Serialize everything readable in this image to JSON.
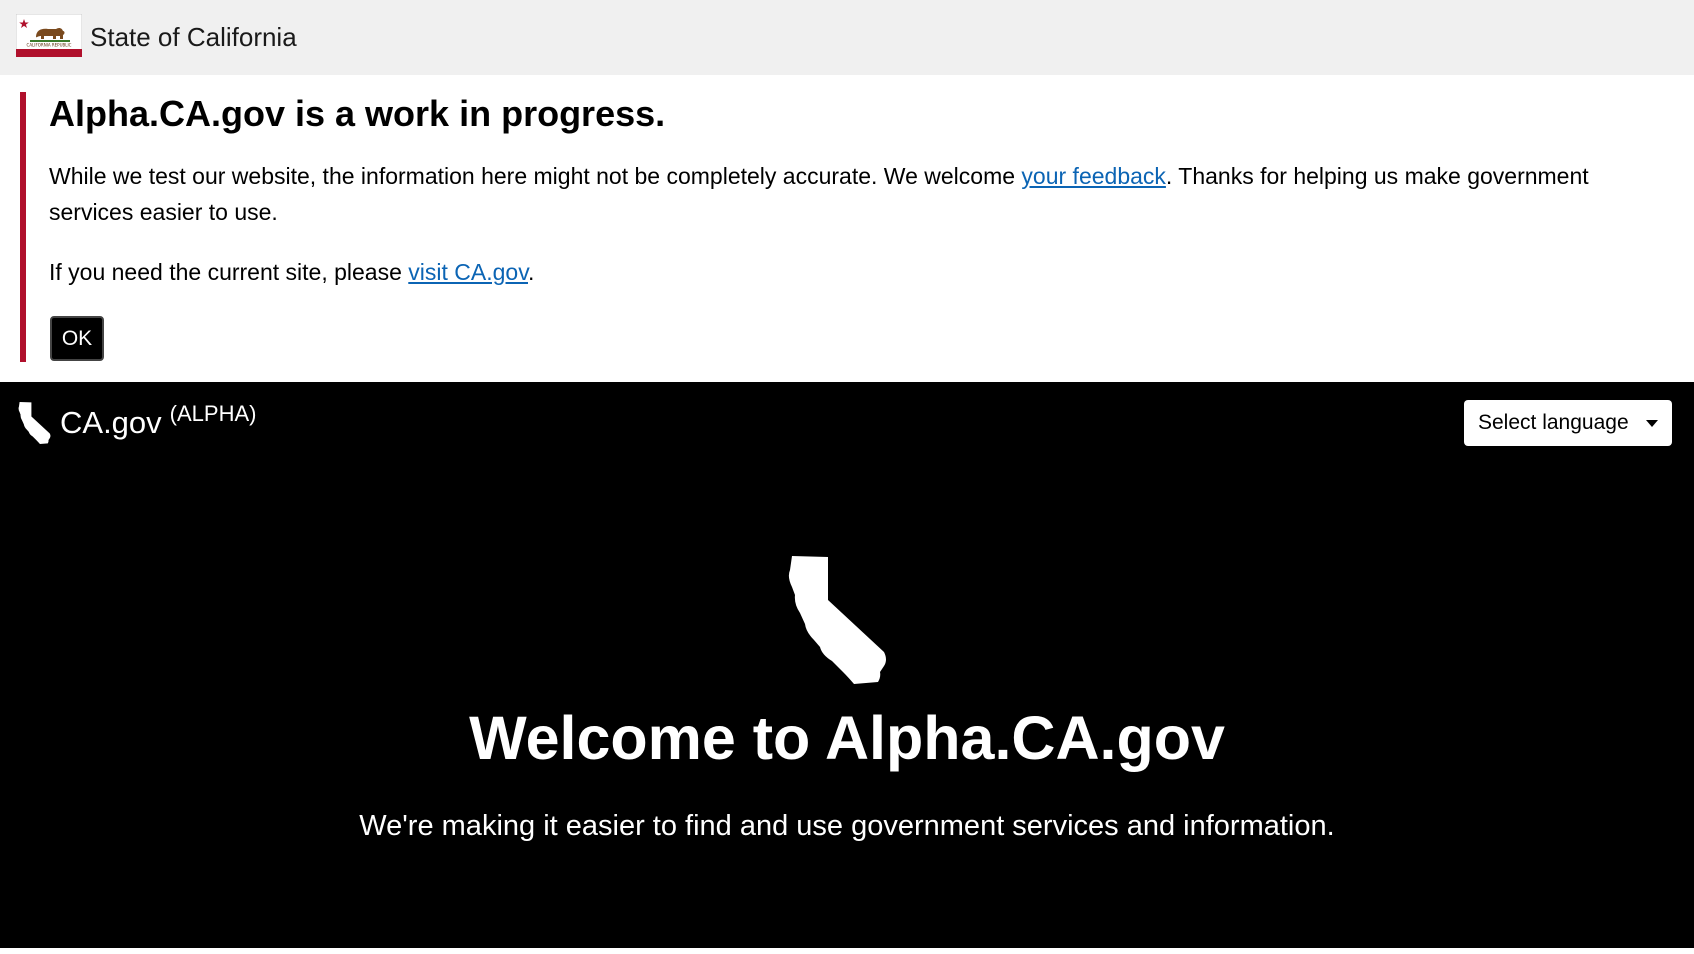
{
  "state_bar": {
    "title": "State of California",
    "flag_icon": "california-flag-icon",
    "flag_caption": "CALIFORNIA REPUBLIC"
  },
  "notice": {
    "title": "Alpha.CA.gov is a work in progress.",
    "p1_before": "While we test our website, the information here might not be completely accurate. We welcome ",
    "p1_link": "your feedback",
    "p1_after": ". Thanks for helping us make government services easier to use.",
    "p2_before": "If you need the current site, please ",
    "p2_link": "visit CA.gov",
    "p2_after": ".",
    "ok_label": "OK",
    "accent_color": "#b0102c",
    "link_color": "#0b64b4"
  },
  "header": {
    "logo_text": "CA.gov",
    "logo_badge": "(ALPHA)",
    "logo_icon": "california-state-icon",
    "language_label": "Select language",
    "language_icon": "caret-down-icon"
  },
  "hero": {
    "icon": "california-state-icon",
    "title": "Welcome to Alpha.CA.gov",
    "subtitle": "We're making it easier to find and use government services and information."
  }
}
